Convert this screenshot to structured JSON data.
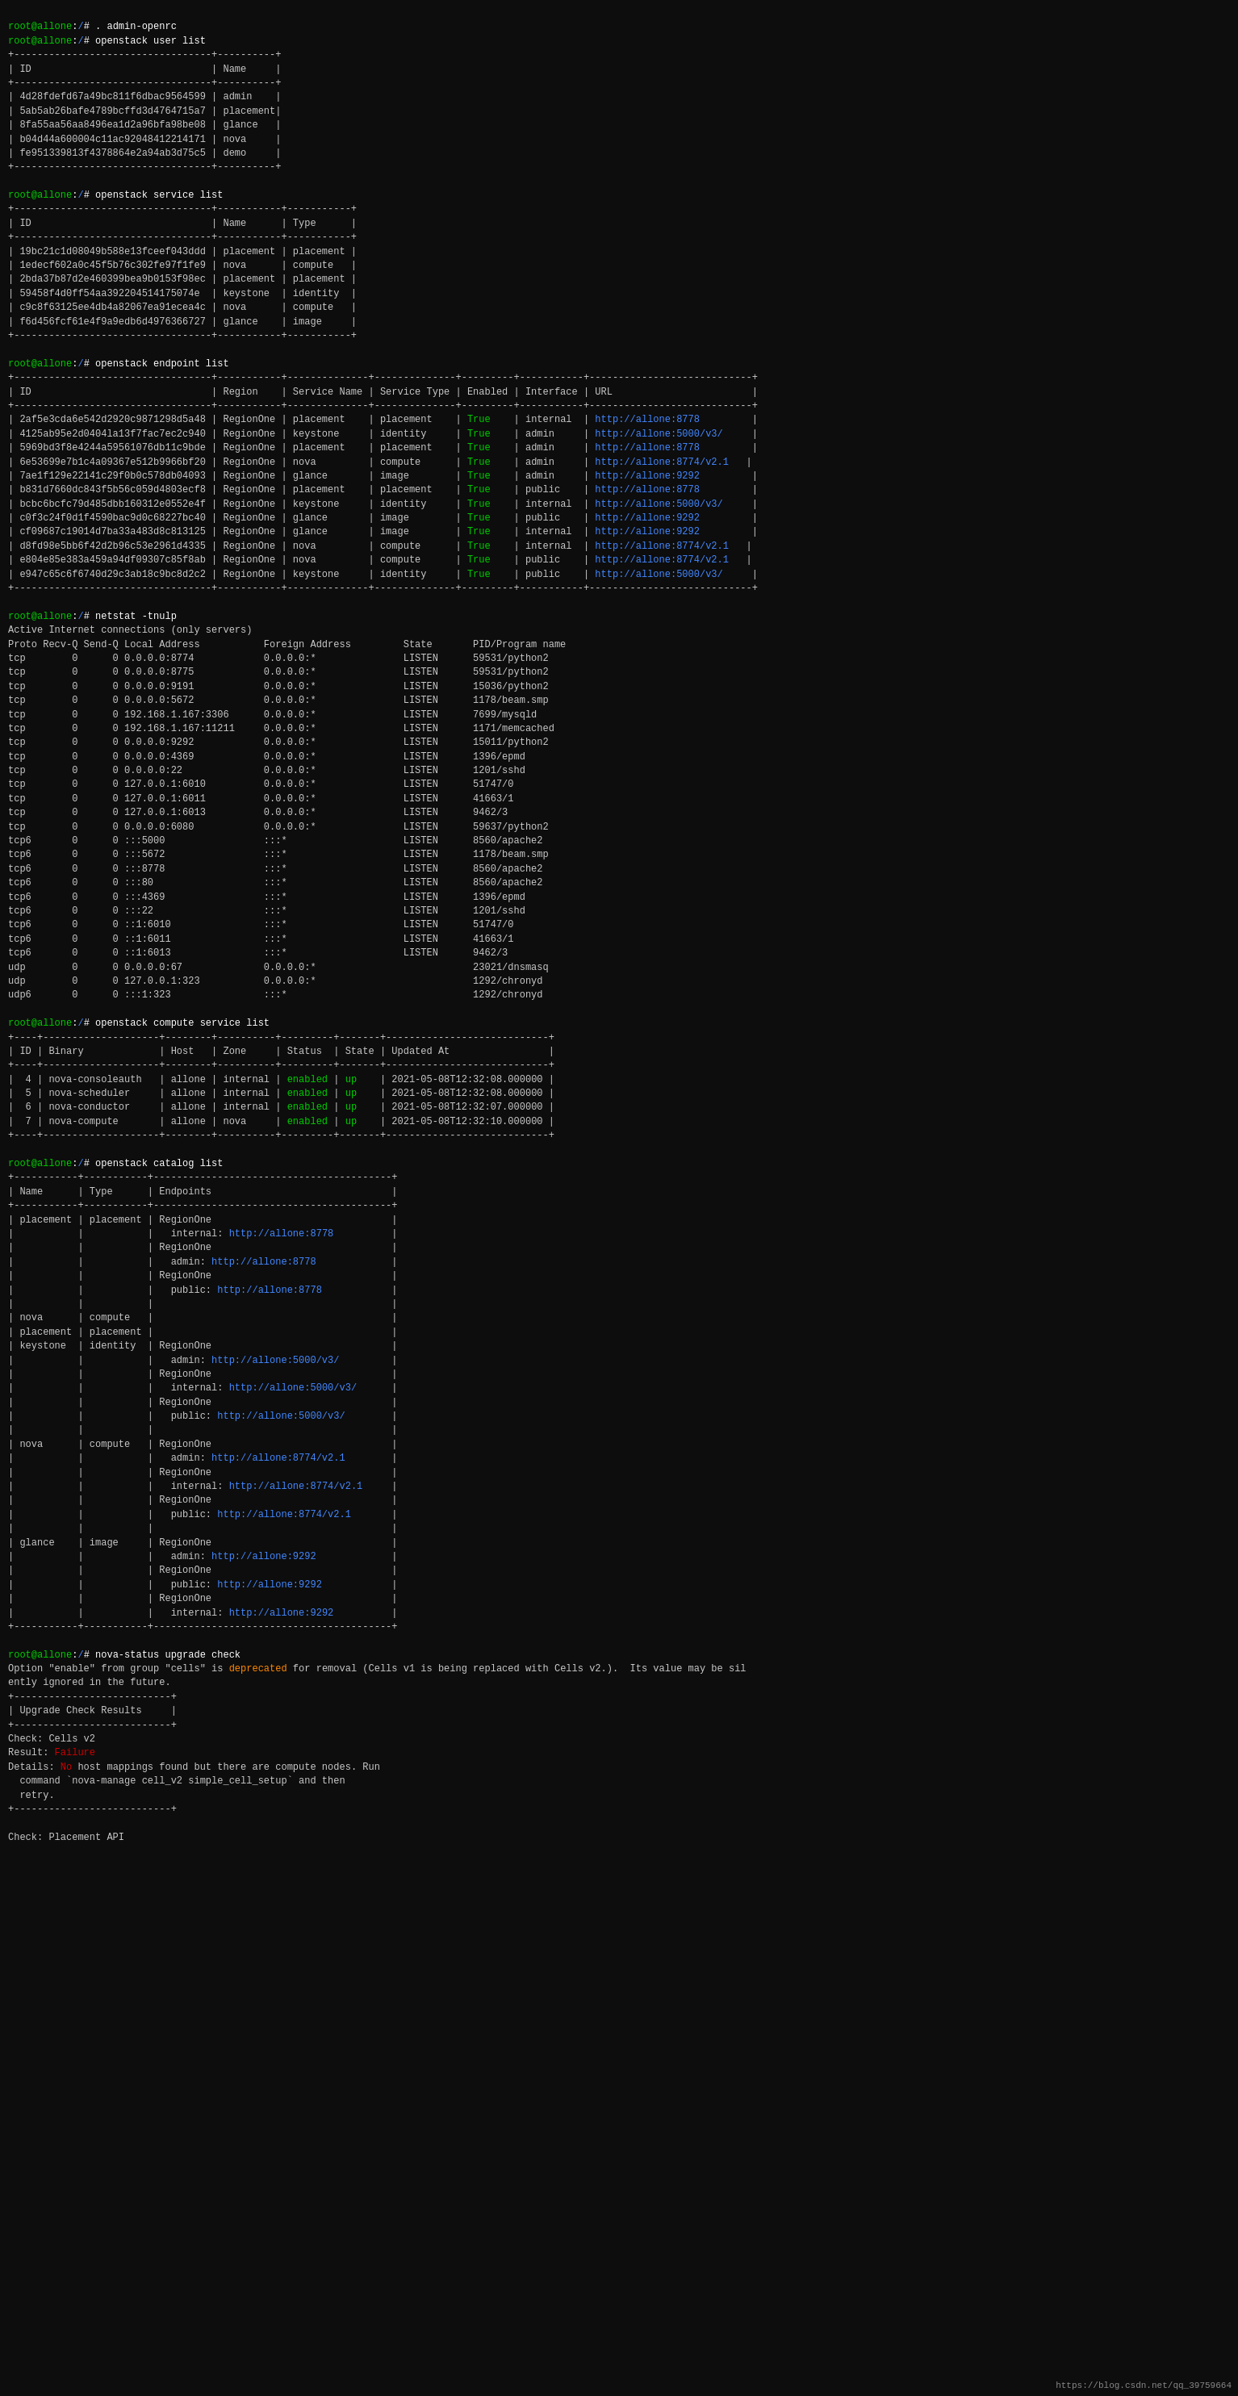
{
  "terminal": {
    "content": "terminal content rendered as HTML"
  }
}
